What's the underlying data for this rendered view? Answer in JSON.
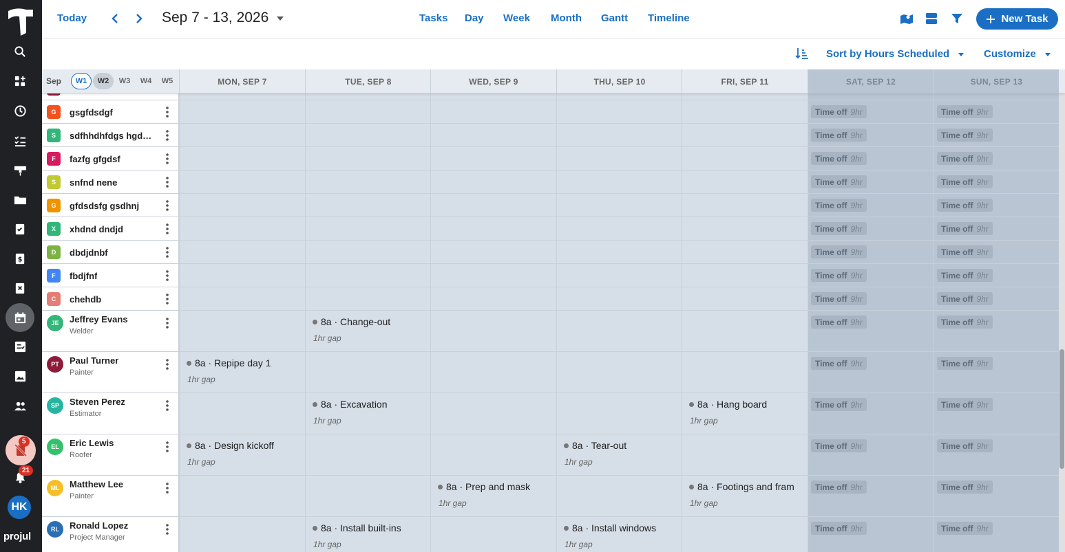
{
  "rail": {
    "notif_badge": "5",
    "bell_badge": "21",
    "avatar": "HK",
    "brand": "projul"
  },
  "toolbar": {
    "today": "Today",
    "range": "Sep 7 - 13, 2026",
    "views": [
      "Tasks",
      "Day",
      "Week",
      "Month",
      "Gantt",
      "Timeline"
    ],
    "new_task": "New Task"
  },
  "subbar": {
    "sort": "Sort by Hours Scheduled",
    "customize": "Customize"
  },
  "header": {
    "month": "Sep",
    "weeks": [
      "W1",
      "W2",
      "W3",
      "W4",
      "W5"
    ],
    "days": [
      "MON, SEP 7",
      "TUE, SEP 8",
      "WED, SEP 9",
      "THU, SEP 10",
      "FRI, SEP 11",
      "SAT, SEP 12",
      "SUN, SEP 13"
    ]
  },
  "time_off": {
    "label": "Time off",
    "hours": "9hr"
  },
  "gap_label": "1hr gap",
  "rows": [
    {
      "initial": "G",
      "name": "gsgfdsdgf",
      "color": "#f4511e"
    },
    {
      "initial": "S",
      "name": "sdfhhdhfdgs hgdhfd",
      "color": "#33b679"
    },
    {
      "initial": "F",
      "name": "fazfg gfgdsf",
      "color": "#d81b60"
    },
    {
      "initial": "S",
      "name": "snfnd nene",
      "color": "#c0ca33"
    },
    {
      "initial": "G",
      "name": "gfdsdsfg gsdhnj",
      "color": "#f09300"
    },
    {
      "initial": "X",
      "name": "xhdnd dndjd",
      "color": "#33b679"
    },
    {
      "initial": "D",
      "name": "dbdjdnbf",
      "color": "#7cb342"
    },
    {
      "initial": "F",
      "name": "fbdjfnf",
      "color": "#4285f4"
    },
    {
      "initial": "C",
      "name": "chehdb",
      "color": "#e67c73"
    }
  ],
  "people": [
    {
      "initials": "JE",
      "name": "Jeffrey Evans",
      "role": "Welder",
      "color": "#33b679",
      "tasks": [
        {
          "day": 1,
          "label": "8a · Change-out"
        }
      ]
    },
    {
      "initials": "PT",
      "name": "Paul Turner",
      "role": "Painter",
      "color": "#8e1a3c",
      "tasks": [
        {
          "day": 0,
          "label": "8a · Repipe day 1"
        }
      ]
    },
    {
      "initials": "SP",
      "name": "Steven Perez",
      "role": "Estimator",
      "color": "#26b5a0",
      "tasks": [
        {
          "day": 1,
          "label": "8a · Excavation"
        },
        {
          "day": 4,
          "label": "8a · Hang board"
        }
      ]
    },
    {
      "initials": "EL",
      "name": "Eric Lewis",
      "role": "Roofer",
      "color": "#33c26b",
      "tasks": [
        {
          "day": 0,
          "label": "8a · Design kickoff"
        },
        {
          "day": 3,
          "label": "8a · Tear-out"
        }
      ]
    },
    {
      "initials": "ML",
      "name": "Matthew Lee",
      "role": "Painter",
      "color": "#f6bf26",
      "tasks": [
        {
          "day": 2,
          "label": "8a · Prep and mask"
        },
        {
          "day": 4,
          "label": "8a · Footings and fram"
        }
      ]
    },
    {
      "initials": "RL",
      "name": "Ronald Lopez",
      "role": "Project Manager",
      "color": "#2a6fb5",
      "tasks": [
        {
          "day": 1,
          "label": "8a · Install built-ins"
        },
        {
          "day": 3,
          "label": "8a · Install windows"
        }
      ]
    }
  ]
}
